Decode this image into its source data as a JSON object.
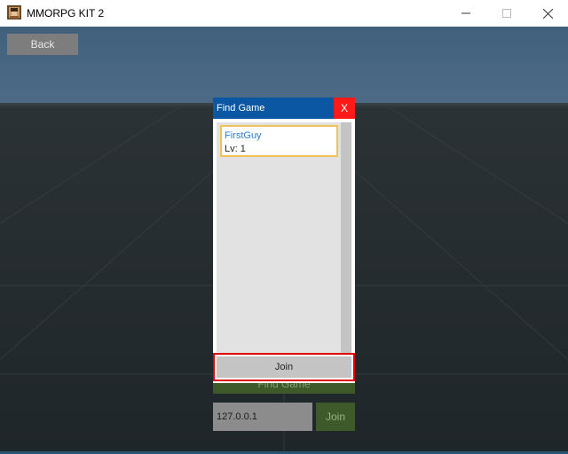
{
  "window": {
    "title": "MMORPG KIT 2",
    "controls": {
      "minimize": "minimize-icon",
      "maximize": "maximize-icon",
      "close": "close-icon"
    }
  },
  "hud": {
    "back_label": "Back"
  },
  "lobby": {
    "find_game_label": "Find Game",
    "address_value": "127.0.0.1",
    "join_label": "Join"
  },
  "dialog": {
    "title": "Find Game",
    "close_label": "X",
    "games": [
      {
        "name": "FirstGuy",
        "level": "Lv: 1"
      }
    ],
    "join_label": "Join"
  },
  "colors": {
    "dialog_header": "#0b57a4",
    "dialog_close": "#ff1a1a",
    "selected_border": "#f0c35a",
    "join_highlight": "#e00000",
    "lobby_button": "#3e5a2a"
  }
}
